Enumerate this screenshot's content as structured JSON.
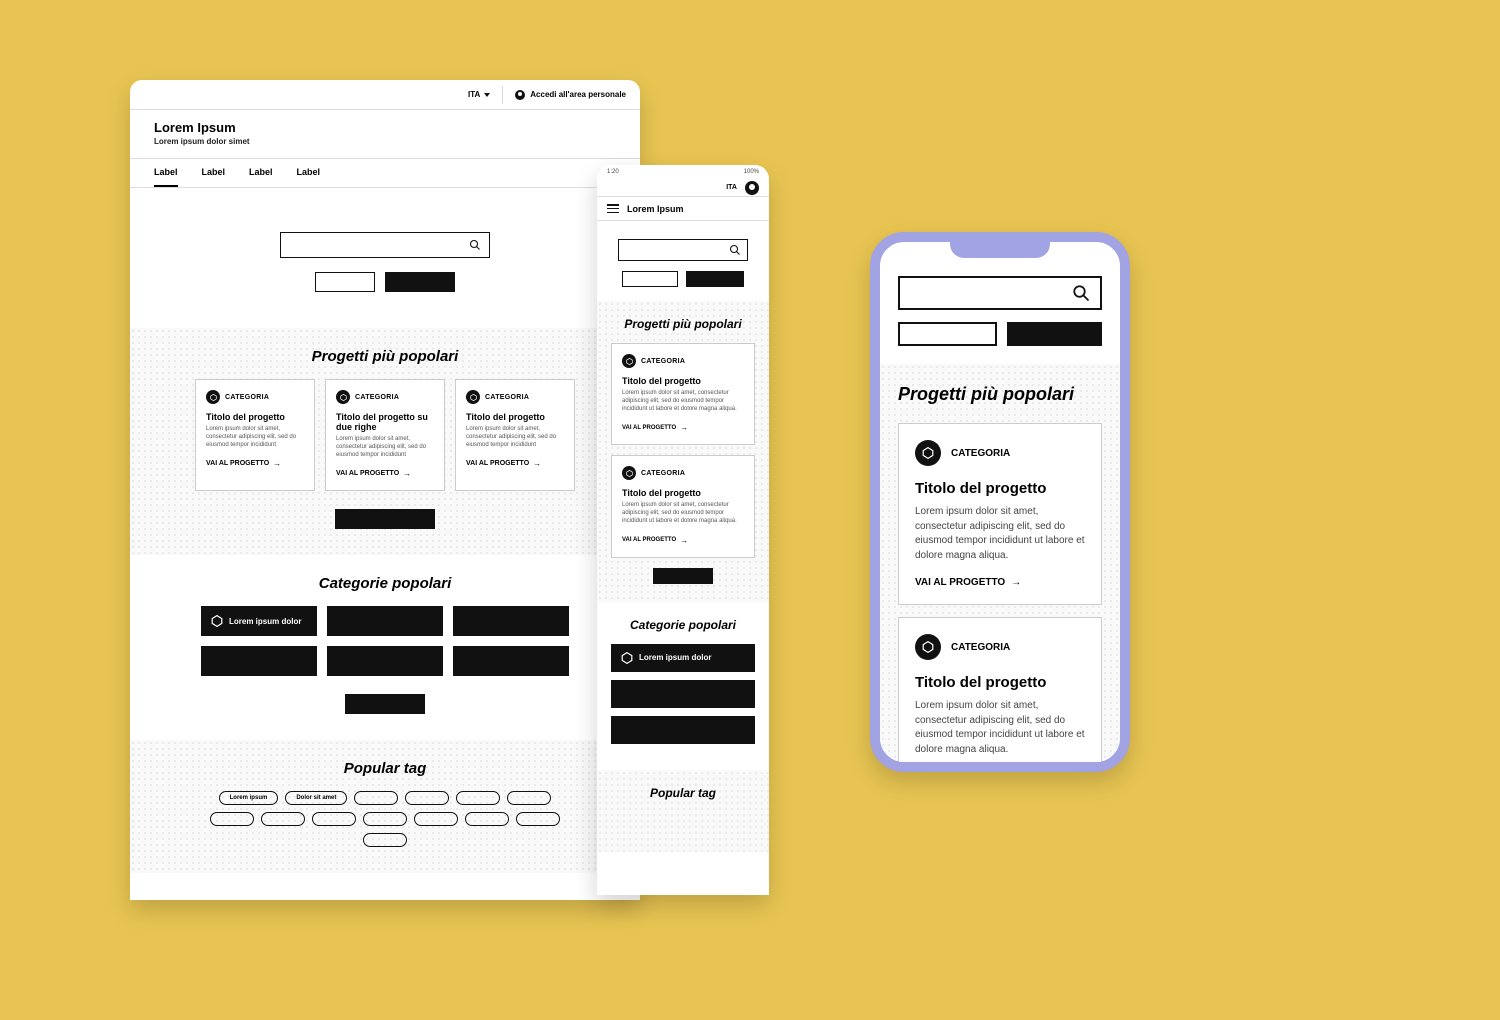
{
  "desktop": {
    "lang": "ITA",
    "access_label": "Accedi all'area personale",
    "title": "Lorem Ipsum",
    "subtitle": "Lorem ipsum dolor simet",
    "tabs": [
      "Label",
      "Label",
      "Label",
      "Label"
    ],
    "projects": {
      "heading": "Progetti più popolari",
      "cards": [
        {
          "category": "CATEGORIA",
          "title": "Titolo del progetto",
          "desc": "Lorem ipsum dolor sit amet, consectetur adipiscing elit, sed do eiusmod tempor incididunt",
          "link": "VAI AL PROGETTO"
        },
        {
          "category": "CATEGORIA",
          "title": "Titolo del progetto su due righe",
          "desc": "Lorem ipsum dolor sit amet, consectetur adipiscing elit, sed do eiusmod tempor incididunt",
          "link": "VAI AL PROGETTO"
        },
        {
          "category": "CATEGORIA",
          "title": "Titolo del progetto",
          "desc": "Lorem ipsum dolor sit amet, consectetur adipiscing elit, sed do eiusmod tempor incididunt",
          "link": "VAI AL PROGETTO"
        }
      ]
    },
    "categories": {
      "heading": "Categorie popolari",
      "first_label": "Lorem ipsum dolor"
    },
    "tags": {
      "heading": "Popular tag",
      "items": [
        "Lorem ipsum",
        "Dolor sit amet"
      ]
    }
  },
  "tablet": {
    "status_time": "1:20",
    "status_battery": "100%",
    "lang": "ITA",
    "title": "Lorem Ipsum",
    "projects": {
      "heading": "Progetti più popolari",
      "cards": [
        {
          "category": "CATEGORIA",
          "title": "Titolo del progetto",
          "desc": "Lorem ipsum dolor sit amet, consectetur adipiscing elit, sed do eiusmod tempor incididunt ut labore et dolore magna aliqua.",
          "link": "VAI AL PROGETTO"
        },
        {
          "category": "CATEGORIA",
          "title": "Titolo del progetto",
          "desc": "Lorem ipsum dolor sit amet, consectetur adipiscing elit, sed do eiusmod tempor incididunt ut labore et dolore magna aliqua.",
          "link": "VAI AL PROGETTO"
        }
      ]
    },
    "categories": {
      "heading": "Categorie popolari",
      "first_label": "Lorem ipsum dolor"
    },
    "tags": {
      "heading": "Popular tag"
    }
  },
  "mobile": {
    "projects": {
      "heading": "Progetti più popolari",
      "cards": [
        {
          "category": "CATEGORIA",
          "title": "Titolo del progetto",
          "desc": "Lorem ipsum dolor sit amet, consectetur adipiscing elit, sed do eiusmod tempor incididunt ut labore et dolore magna aliqua.",
          "link": "VAI AL PROGETTO"
        },
        {
          "category": "CATEGORIA",
          "title": "Titolo del progetto",
          "desc": "Lorem ipsum dolor sit amet, consectetur adipiscing elit, sed do eiusmod tempor incididunt ut labore et dolore magna aliqua."
        }
      ]
    }
  }
}
